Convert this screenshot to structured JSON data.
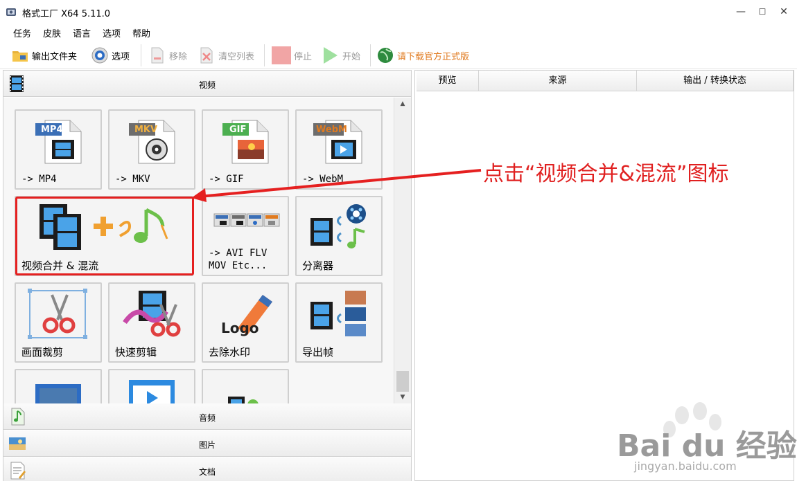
{
  "window": {
    "title": "格式工厂 X64 5.11.0",
    "minimize": "—",
    "maximize": "☐",
    "close": "✕"
  },
  "menu": [
    "任务",
    "皮肤",
    "语言",
    "选项",
    "帮助"
  ],
  "toolbar": {
    "output_folder": "输出文件夹",
    "options": "选项",
    "remove": "移除",
    "clear_list": "清空列表",
    "stop": "停止",
    "start": "开始",
    "download_official": "请下载官方正式版"
  },
  "categories": {
    "video": "视频",
    "audio": "音频",
    "image": "图片",
    "document": "文档"
  },
  "tiles": {
    "mp4": {
      "label": "-> MP4",
      "badge": "MP4"
    },
    "mkv": {
      "label": "-> MKV",
      "badge": "MKV"
    },
    "gif": {
      "label": "-> GIF",
      "badge": "GIF"
    },
    "webm": {
      "label": "-> WebM",
      "badge": "WebM"
    },
    "merge": {
      "label": "视频合并 & 混流"
    },
    "avi": {
      "label": "-> AVI FLV\nMOV Etc..."
    },
    "splitter": {
      "label": "分离器"
    },
    "crop": {
      "label": "画面裁剪"
    },
    "quick_cut": {
      "label": "快速剪辑"
    },
    "watermark": {
      "label": "去除水印",
      "logo": "Logo"
    },
    "export_frames": {
      "label": "导出帧"
    }
  },
  "queue_columns": [
    "预览",
    "来源",
    "输出 / 转换状态"
  ],
  "annotation": "点击“视频合并&混流”图标",
  "watermark": {
    "brand": "Bai du 经验",
    "url": "jingyan.baidu.com"
  },
  "colors": {
    "accent_red": "#e52020",
    "mp4_blue": "#3b6fb6",
    "mkv_gray": "#6d6d6d",
    "gif_green": "#4caf50",
    "webm_orange": "#e07a1f"
  }
}
